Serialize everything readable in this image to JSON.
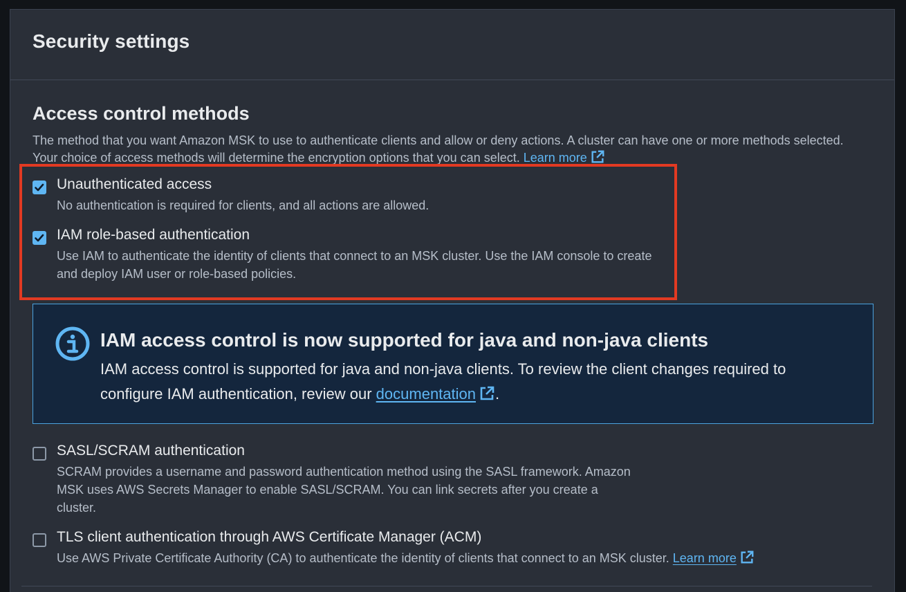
{
  "panel": {
    "title": "Security settings"
  },
  "access_control": {
    "title": "Access control methods",
    "description": "The method that you want Amazon MSK to use to authenticate clients and allow or deny actions. A cluster can have one or more methods selected. Your choice of access methods will determine the encryption options that you can select.",
    "learn_more": "Learn more"
  },
  "options": [
    {
      "label": "Unauthenticated access",
      "description": "No authentication is required for clients, and all actions are allowed.",
      "checked": true
    },
    {
      "label": "IAM role-based authentication",
      "description": "Use IAM to authenticate the identity of clients that connect to an MSK cluster. Use the IAM console to create and deploy IAM user or role-based policies.",
      "checked": true
    },
    {
      "label": "SASL/SCRAM authentication",
      "description": "SCRAM provides a username and password authentication method using the SASL framework. Amazon MSK uses AWS Secrets Manager to enable SASL/SCRAM. You can link secrets after you create a cluster.",
      "checked": false
    },
    {
      "label": "TLS client authentication through AWS Certificate Manager (ACM)",
      "description": "Use AWS Private Certificate Authority (CA) to authenticate the identity of clients that connect to an MSK cluster.",
      "learn_more": "Learn more",
      "checked": false
    }
  ],
  "alert": {
    "title": "IAM access control is now supported for java and non-java clients",
    "body_prefix": "IAM access control is supported for java and non-java clients. To review the client changes required to configure IAM authentication, review our",
    "link": "documentation",
    "body_suffix": "."
  },
  "colors": {
    "accent": "#5fb6f3",
    "highlight": "#e23a22",
    "info_border": "#4ba3e0"
  },
  "icons": {
    "checkbox_checked": "check-icon",
    "external_link": "external-link-icon",
    "info": "info-icon"
  }
}
